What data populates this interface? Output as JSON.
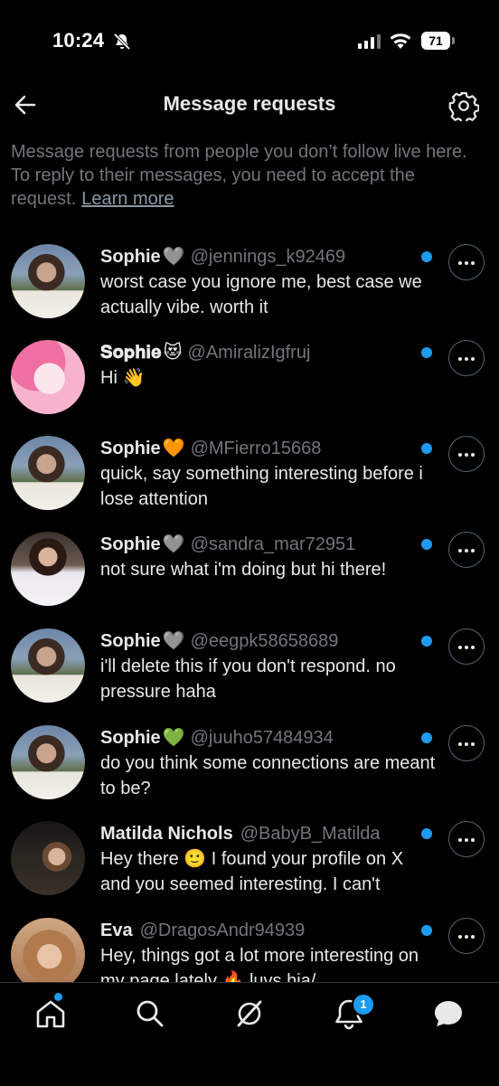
{
  "status_bar": {
    "time": "10:24",
    "battery": "71"
  },
  "header": {
    "title": "Message requests"
  },
  "info": {
    "text": "Message requests from people you don’t follow live here. To reply to their messages, you need to accept the request.",
    "link": "Learn more"
  },
  "requests": [
    {
      "name": "Sophie",
      "emoji": "🩶",
      "handle": "@jennings_k92469",
      "message": "worst case you ignore me, best case we actually vibe. worth it",
      "unread": true
    },
    {
      "name": "𝐒𝐨𝐩𝐡𝐢𝐞",
      "emoji": "😻",
      "handle": "@AmiralizIgfruj",
      "message": "Hi 👋",
      "unread": true
    },
    {
      "name": "Sophie",
      "emoji": "🧡",
      "handle": "@MFierro15668",
      "message": "quick, say something interesting before i lose attention",
      "unread": true
    },
    {
      "name": "Sophie",
      "emoji": "🩶",
      "handle": "@sandra_mar72951",
      "message": "not sure what i'm doing but hi there!",
      "unread": true
    },
    {
      "name": "Sophie",
      "emoji": "🩶",
      "handle": "@eegpk58658689",
      "message": "i'll delete this if you don't respond. no pressure haha",
      "unread": true
    },
    {
      "name": "Sophie",
      "emoji": "💚",
      "handle": "@juuho57484934",
      "message": "do you think some connections are meant to be?",
      "unread": true
    },
    {
      "name": "Matilda Nichols",
      "emoji": "",
      "handle": "@BabyB_Matilda",
      "message": "Hey there 🙂 I found your profile on X and you seemed interesting. I can't",
      "unread": true
    },
    {
      "name": "Eva",
      "emoji": "",
      "handle": "@DragosAndr94939",
      "message": "Hey, things got a lot more interesting on my page lately 🔥 luvs hia/",
      "unread": true
    }
  ],
  "tabbar": {
    "notifications_count": "1"
  },
  "colors": {
    "accent": "#1d9bf0",
    "background": "#000000",
    "secondary_text": "#71767b"
  },
  "icons": [
    "back-arrow-icon",
    "gear-icon",
    "home-icon",
    "search-icon",
    "grok-icon",
    "bell-icon",
    "messages-icon",
    "more-dots-icon"
  ]
}
